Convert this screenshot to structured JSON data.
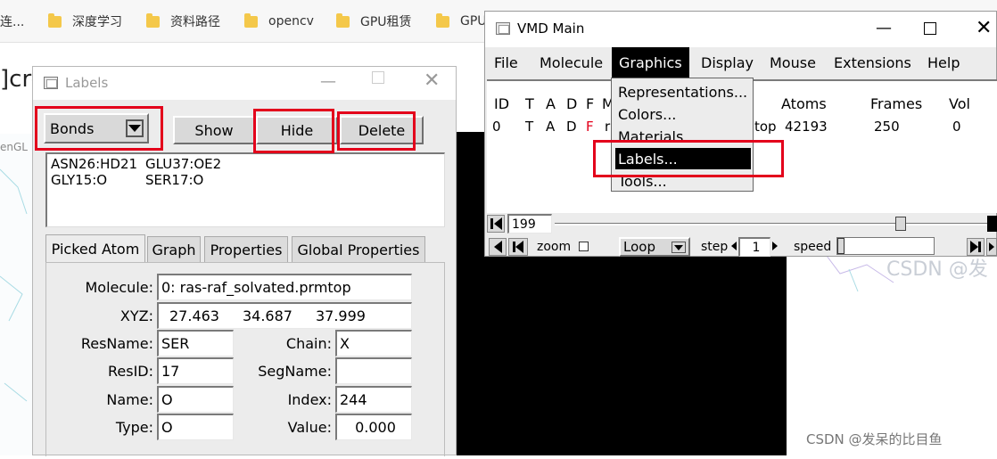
{
  "browser": {
    "bookmarks": [
      "连...",
      "深度学习",
      "资料路径",
      "opencv",
      "GPU租赁",
      "GPU"
    ],
    "page_title_fragment": "]cro",
    "side_text": "enGL",
    "watermark_top": "CSDN @发",
    "watermark_bottom": "CSDN @发呆的比目鱼"
  },
  "labels_window": {
    "title": "Labels",
    "category_select": "Bonds",
    "buttons": {
      "show": "Show",
      "hide": "Hide",
      "delete": "Delete"
    },
    "bond_list": [
      {
        "a": "ASN26:HD21",
        "b": "GLU37:OE2"
      },
      {
        "a": "GLY15:O",
        "b": "SER17:O"
      }
    ],
    "tabs": [
      "Picked Atom",
      "Graph",
      "Properties",
      "Global Properties"
    ],
    "picked_atom": {
      "molecule_label": "Molecule:",
      "molecule": "0: ras-raf_solvated.prmtop",
      "xyz_label": "XYZ:",
      "x": "27.463",
      "y": "34.687",
      "z": "37.999",
      "resname_label": "ResName:",
      "resname": "SER",
      "chain_label": "Chain:",
      "chain": "X",
      "resid_label": "ResID:",
      "resid": "17",
      "segname_label": "SegName:",
      "segname": "",
      "name_label": "Name:",
      "name": "O",
      "index_label": "Index:",
      "index": "244",
      "type_label": "Type:",
      "type": "O",
      "value_label": "Value:",
      "value": "0.000"
    }
  },
  "vmd_window": {
    "title": "VMD Main",
    "menubar": [
      "File",
      "Molecule",
      "Graphics",
      "Display",
      "Mouse",
      "Extensions",
      "Help"
    ],
    "columns": {
      "id": "ID",
      "t": "T",
      "a": "A",
      "d": "D",
      "f": "F",
      "m": "M",
      "atoms": "Atoms",
      "frames": "Frames",
      "vol": "Vol"
    },
    "row": {
      "id": "0",
      "t": "T",
      "a": "A",
      "d": "D",
      "f": "F",
      "name_start": "ra",
      "name_end": "top",
      "atoms": "42193",
      "frames": "250",
      "vol": "0"
    },
    "graphics_menu": [
      "Representations...",
      "Colors...",
      "Materials...",
      "Labels...",
      "Tools..."
    ],
    "frame": "199",
    "zoom_label": "zoom",
    "loop_select": "Loop",
    "step_label": "step",
    "step_value": "1",
    "speed_label": "speed",
    "frame_slider_fraction": 0.8
  },
  "colors": {
    "highlight": "#e3001b",
    "flag_red": "#e3001b"
  }
}
